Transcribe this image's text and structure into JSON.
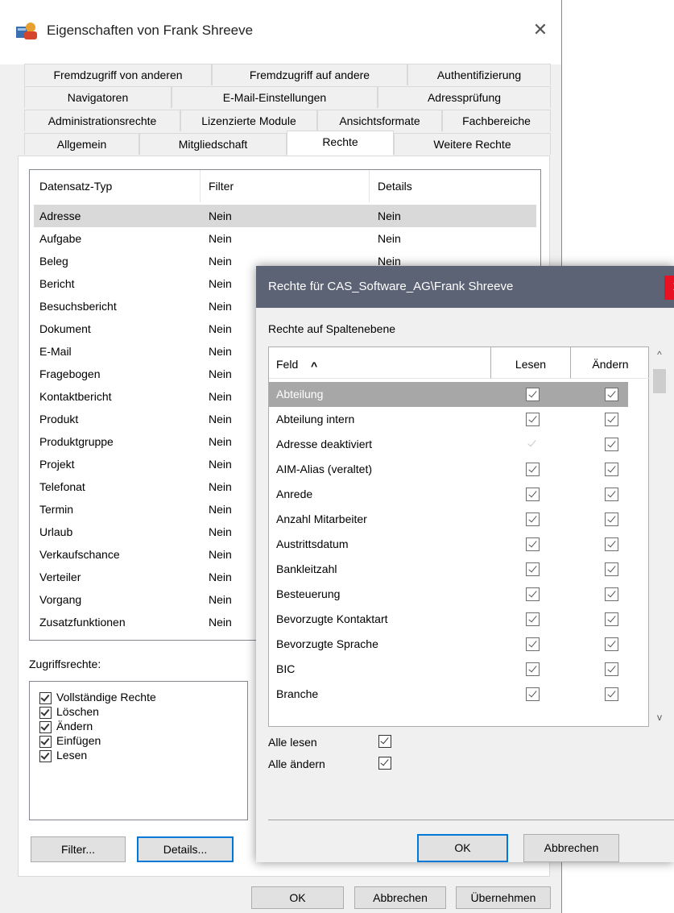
{
  "window": {
    "title": "Eigenschaften von Frank Shreeve",
    "close_symbol": "✕"
  },
  "tabs": {
    "row1": [
      "Fremdzugriff von anderen",
      "Fremdzugriff auf andere",
      "Authentifizierung"
    ],
    "row2": [
      "Navigatoren",
      "E-Mail-Einstellungen",
      "Adressprüfung"
    ],
    "row3": [
      "Administrationsrechte",
      "Lizenzierte Module",
      "Ansichtsformate",
      "Fachbereiche"
    ],
    "row4": [
      "Allgemein",
      "Mitgliedschaft",
      "Rechte",
      "Weitere Rechte"
    ],
    "active": "Rechte"
  },
  "records": {
    "headers": [
      "Datensatz-Typ",
      "Filter",
      "Details"
    ],
    "rows": [
      {
        "typ": "Adresse",
        "filter": "Nein",
        "details": "Nein"
      },
      {
        "typ": "Aufgabe",
        "filter": "Nein",
        "details": "Nein"
      },
      {
        "typ": "Beleg",
        "filter": "Nein",
        "details": "Nein"
      },
      {
        "typ": "Bericht",
        "filter": "Nein"
      },
      {
        "typ": "Besuchsbericht",
        "filter": "Nein"
      },
      {
        "typ": "Dokument",
        "filter": "Nein"
      },
      {
        "typ": "E-Mail",
        "filter": "Nein"
      },
      {
        "typ": "Fragebogen",
        "filter": "Nein"
      },
      {
        "typ": "Kontaktbericht",
        "filter": "Nein"
      },
      {
        "typ": "Produkt",
        "filter": "Nein"
      },
      {
        "typ": "Produktgruppe",
        "filter": "Nein"
      },
      {
        "typ": "Projekt",
        "filter": "Nein"
      },
      {
        "typ": "Telefonat",
        "filter": "Nein"
      },
      {
        "typ": "Termin",
        "filter": "Nein"
      },
      {
        "typ": "Urlaub",
        "filter": "Nein"
      },
      {
        "typ": "Verkaufschance",
        "filter": "Nein"
      },
      {
        "typ": "Verteiler",
        "filter": "Nein"
      },
      {
        "typ": "Vorgang",
        "filter": "Nein"
      },
      {
        "typ": "Zusatzfunktionen",
        "filter": "Nein"
      }
    ],
    "selected": "Adresse"
  },
  "access": {
    "label": "Zugriffsrechte:",
    "items": [
      {
        "label": "Vollständige Rechte",
        "checked": true
      },
      {
        "label": "Löschen",
        "checked": true
      },
      {
        "label": "Ändern",
        "checked": true
      },
      {
        "label": "Einfügen",
        "checked": true
      },
      {
        "label": "Lesen",
        "checked": true
      }
    ]
  },
  "buttons": {
    "filter": "Filter...",
    "details": "Details...",
    "ok": "OK",
    "cancel": "Abbrechen",
    "apply": "Übernehmen"
  },
  "dialog": {
    "title": "Rechte für CAS_Software_AG\\Frank Shreeve",
    "close_symbol": "x",
    "subtitle": "Rechte auf Spaltenebene",
    "columns": {
      "field": "Feld",
      "sort_icon": "^",
      "read": "Lesen",
      "change": "Ändern"
    },
    "rows": [
      {
        "field": "Abteilung",
        "read": true,
        "change": true,
        "selected": true
      },
      {
        "field": "Abteilung intern",
        "read": true,
        "change": true
      },
      {
        "field": "Adresse deaktiviert",
        "read": false,
        "change": true
      },
      {
        "field": "AIM-Alias (veraltet)",
        "read": true,
        "change": true
      },
      {
        "field": "Anrede",
        "read": true,
        "change": true
      },
      {
        "field": "Anzahl Mitarbeiter",
        "read": true,
        "change": true
      },
      {
        "field": "Austrittsdatum",
        "read": true,
        "change": true
      },
      {
        "field": "Bankleitzahl",
        "read": true,
        "change": true
      },
      {
        "field": "Besteuerung",
        "read": true,
        "change": true
      },
      {
        "field": "Bevorzugte Kontaktart",
        "read": true,
        "change": true
      },
      {
        "field": "Bevorzugte Sprache",
        "read": true,
        "change": true
      },
      {
        "field": "BIC",
        "read": true,
        "change": true
      },
      {
        "field": "Branche",
        "read": true,
        "change": true
      }
    ],
    "all_read": {
      "label": "Alle lesen",
      "checked": true
    },
    "all_change": {
      "label": "Alle ändern",
      "checked": true
    },
    "ok": "OK",
    "cancel": "Abbrechen",
    "scroll_up": "^",
    "scroll_down": "v"
  }
}
